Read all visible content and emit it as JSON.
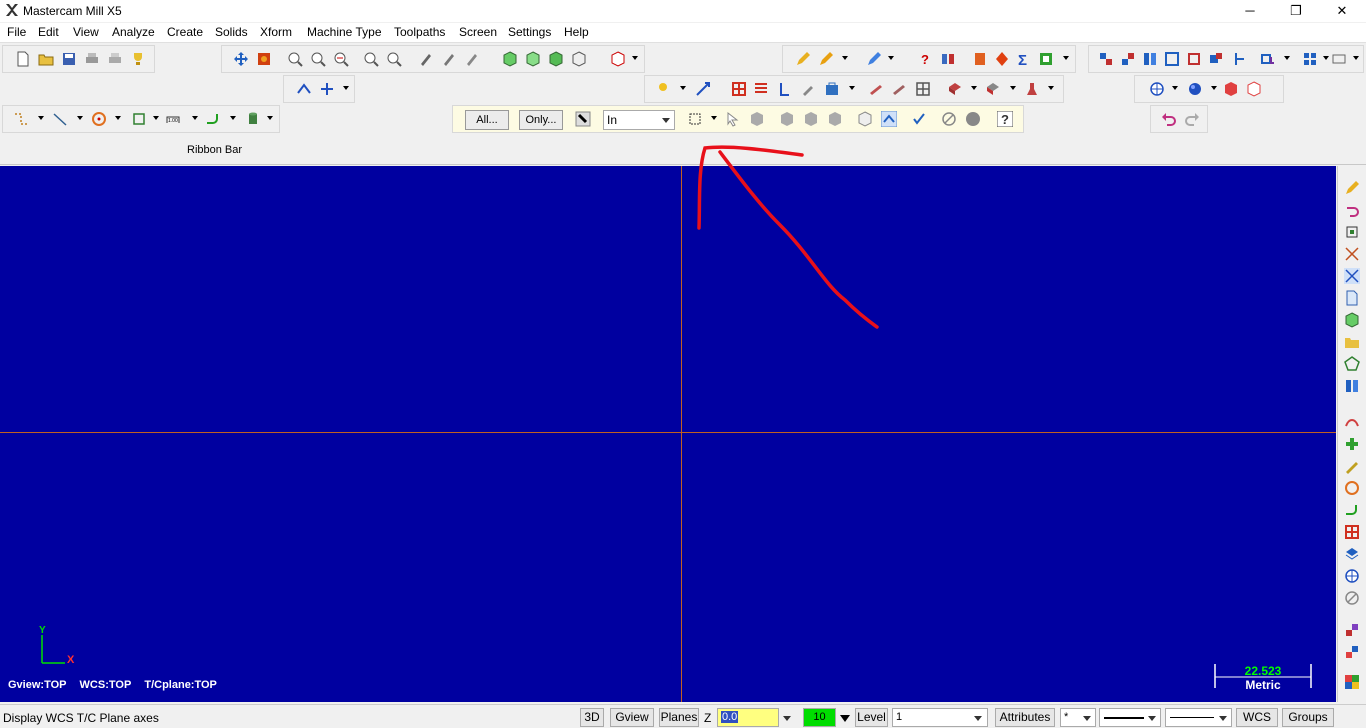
{
  "window": {
    "title": "Mastercam Mill X5",
    "minimize": "─",
    "maximize": "❐",
    "close": "✕"
  },
  "menu": [
    "File",
    "Edit",
    "View",
    "Analyze",
    "Create",
    "Solids",
    "Xform",
    "Machine Type",
    "Toolpaths",
    "Screen",
    "Settings",
    "Help"
  ],
  "selection_bar": {
    "all_label": "All...",
    "only_label": "Only...",
    "mode_value": "In"
  },
  "ribbon": {
    "label": "Ribbon Bar"
  },
  "viewport": {
    "background": "#0000a0",
    "gview": "Gview:TOP",
    "wcs": "WCS:TOP",
    "tcplane": "T/Cplane:TOP",
    "axis_y": "Y",
    "axis_x": "X",
    "scale_value": "22.523",
    "scale_unit": "Metric"
  },
  "status": {
    "message": "Display WCS  T/C Plane axes",
    "btn_3d": "3D",
    "btn_gview": "Gview",
    "btn_planes": "Planes",
    "z_label": "Z",
    "z_value": "0.0",
    "color_value": "10",
    "level_label": "Level",
    "level_value": "1",
    "attributes": "Attributes",
    "point_style": "*",
    "wcs": "WCS",
    "groups": "Groups"
  },
  "colors": {
    "annotation": "#e8101a",
    "grid_axis": "#c06020",
    "z_field": "#ffff80",
    "color_field": "#00dd00"
  }
}
